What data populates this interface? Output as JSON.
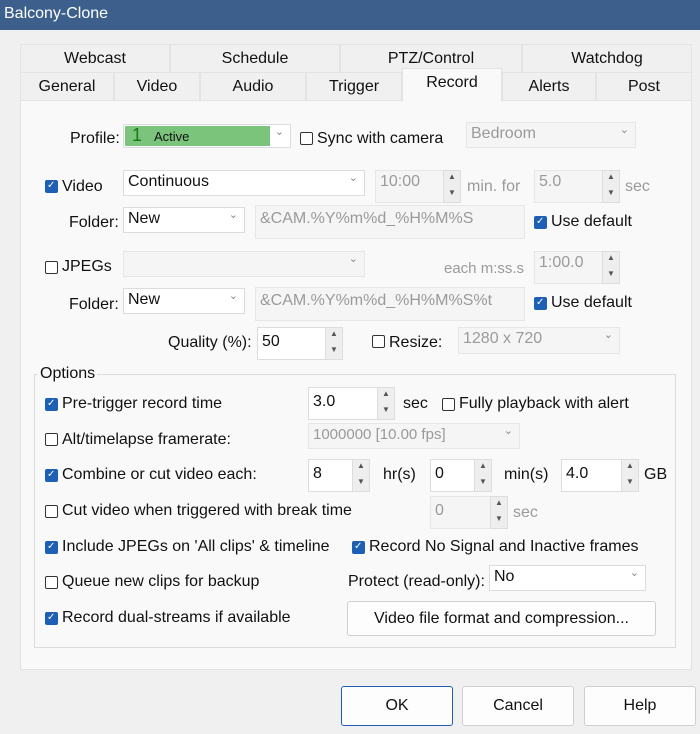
{
  "window": {
    "title": "Balcony-Clone"
  },
  "tabs_row1": [
    "Webcast",
    "Schedule",
    "PTZ/Control",
    "Watchdog"
  ],
  "tabs_row2": [
    "General",
    "Video",
    "Audio",
    "Trigger",
    "Record",
    "Alerts",
    "Post"
  ],
  "profile": {
    "label": "Profile:",
    "number": "1",
    "value": "Active",
    "color": "#7bc47b",
    "sync_label": "Sync with camera",
    "sync_checked": false,
    "camera": "Bedroom"
  },
  "video": {
    "label": "Video",
    "checked": true,
    "mode": "Continuous",
    "time": "10:00",
    "min_for": "min. for",
    "sec_value": "5.0",
    "sec": "sec",
    "folder_label": "Folder:",
    "folder": "New",
    "pattern": "&CAM.%Y%m%d_%H%M%S",
    "use_default": "Use default"
  },
  "jpegs": {
    "label": "JPEGs",
    "checked": false,
    "mode": "",
    "each_label": "each m:ss.s",
    "each_value": "1:00.0",
    "folder_label": "Folder:",
    "folder": "New",
    "pattern": "&CAM.%Y%m%d_%H%M%S%t",
    "use_default": "Use default",
    "quality_label": "Quality (%):",
    "quality": "50",
    "resize_label": "Resize:",
    "resize": "1280 x 720"
  },
  "options": {
    "title": "Options",
    "pretrigger": {
      "label": "Pre-trigger record time",
      "value": "3.0",
      "unit": "sec"
    },
    "fully_playback": "Fully playback with alert",
    "alt_framerate": {
      "label": "Alt/timelapse framerate:",
      "value": "1000000 [10.00 fps]"
    },
    "combine": {
      "label": "Combine or cut video each:",
      "hrs": "8",
      "hrs_unit": "hr(s)",
      "mins": "0",
      "mins_unit": "min(s)",
      "gb": "4.0",
      "gb_unit": "GB"
    },
    "cut_triggered": {
      "label": "Cut video when triggered with break time",
      "value": "0",
      "unit": "sec"
    },
    "include_jpegs": "Include JPEGs on 'All clips' & timeline",
    "record_nosignal": "Record No Signal and Inactive frames",
    "queue_backup": "Queue new clips for backup",
    "protect": {
      "label": "Protect (read-only):",
      "value": "No"
    },
    "dual_streams": "Record dual-streams if available",
    "format_button": "Video file format and compression..."
  },
  "buttons": {
    "ok": "OK",
    "cancel": "Cancel",
    "help": "Help"
  }
}
